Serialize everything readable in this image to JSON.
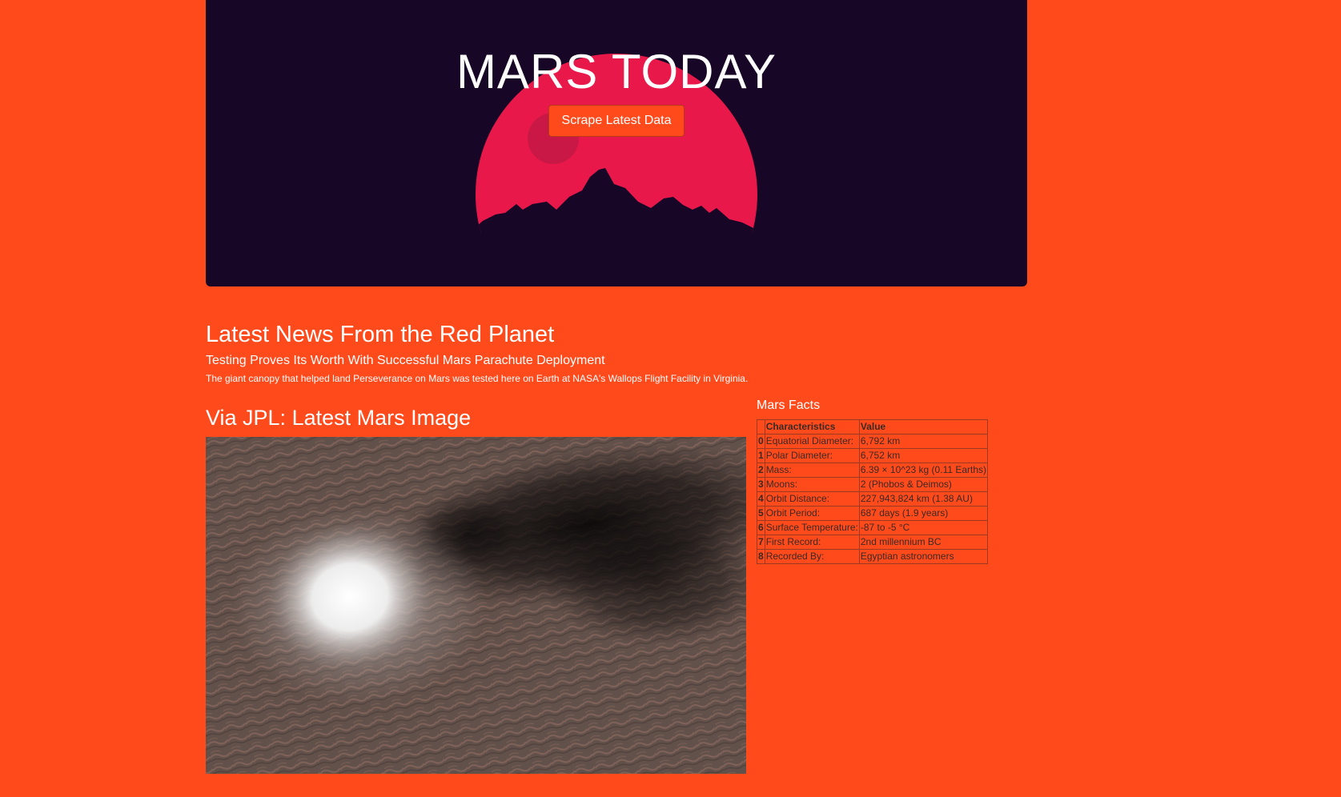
{
  "header": {
    "title": "MARS TODAY",
    "scrape_button": "Scrape Latest Data"
  },
  "news": {
    "heading": "Latest News From the Red Planet",
    "title": "Testing Proves Its Worth With Successful Mars Parachute Deployment",
    "teaser": "The giant canopy that helped land Perseverance on Mars was tested here on Earth at NASA's Wallops Flight Facility in Virginia."
  },
  "featured_image": {
    "heading": "Via JPL: Latest Mars Image"
  },
  "facts": {
    "heading": "Mars Facts",
    "columns": [
      "",
      "Characteristics",
      "Value"
    ],
    "rows": [
      {
        "index": "0",
        "characteristic": "Equatorial Diameter:",
        "value": "6,792 km"
      },
      {
        "index": "1",
        "characteristic": "Polar Diameter:",
        "value": "6,752 km"
      },
      {
        "index": "2",
        "characteristic": "Mass:",
        "value": "6.39 × 10^23 kg (0.11 Earths)"
      },
      {
        "index": "3",
        "characteristic": "Moons:",
        "value": "2 (Phobos & Deimos)"
      },
      {
        "index": "4",
        "characteristic": "Orbit Distance:",
        "value": "227,943,824 km (1.38 AU)"
      },
      {
        "index": "5",
        "characteristic": "Orbit Period:",
        "value": "687 days (1.9 years)"
      },
      {
        "index": "6",
        "characteristic": "Surface Temperature:",
        "value": "-87 to -5 °C"
      },
      {
        "index": "7",
        "characteristic": "First Record:",
        "value": "2nd millennium BC"
      },
      {
        "index": "8",
        "characteristic": "Recorded By:",
        "value": "Egyptian astronomers"
      }
    ]
  },
  "colors": {
    "page_background": "#FF4A1C",
    "header_background": "#170625",
    "planet": "#E8194A",
    "button": "#FF4A1C"
  }
}
